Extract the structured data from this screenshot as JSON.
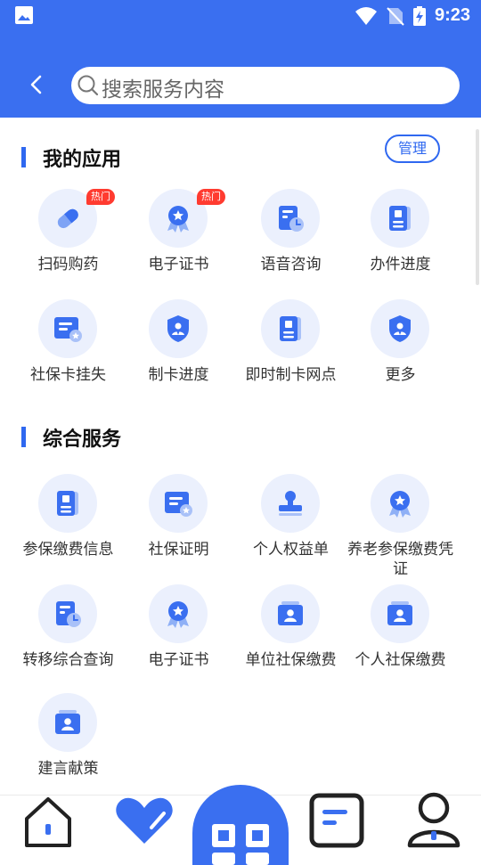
{
  "status_bar": {
    "time": "9:23",
    "icons": [
      "image-icon",
      "wifi-icon",
      "no-sim-icon",
      "battery-charging-icon"
    ]
  },
  "header": {
    "search_placeholder": "搜索服务内容",
    "back_icon": "chevron-left-icon"
  },
  "my_apps": {
    "title": "我的应用",
    "manage_label": "管理",
    "items": [
      {
        "label": "扫码购药",
        "icon": "pill-icon",
        "badge": "热门"
      },
      {
        "label": "电子证书",
        "icon": "medal-icon",
        "badge": "热门"
      },
      {
        "label": "语音咨询",
        "icon": "document-clock-icon",
        "badge": ""
      },
      {
        "label": "办件进度",
        "icon": "book-icon",
        "badge": ""
      },
      {
        "label": "社保卡挂失",
        "icon": "card-star-icon",
        "badge": ""
      },
      {
        "label": "制卡进度",
        "icon": "shield-user-icon",
        "badge": ""
      },
      {
        "label": "即时制卡网点",
        "icon": "book-icon",
        "badge": ""
      },
      {
        "label": "更多",
        "icon": "shield-user-icon",
        "badge": ""
      }
    ]
  },
  "services": {
    "title": "综合服务",
    "items": [
      {
        "label": "参保缴费信息",
        "icon": "book-icon"
      },
      {
        "label": "社保证明",
        "icon": "card-star-icon"
      },
      {
        "label": "个人权益单",
        "icon": "stamp-icon"
      },
      {
        "label": "养老参保缴费凭证",
        "icon": "medal-icon"
      },
      {
        "label": "转移综合查询",
        "icon": "document-clock-icon"
      },
      {
        "label": "电子证书",
        "icon": "medal-icon"
      },
      {
        "label": "单位社保缴费",
        "icon": "id-card-icon"
      },
      {
        "label": "个人社保缴费",
        "icon": "id-card-icon"
      },
      {
        "label": "建言献策",
        "icon": "id-card-icon"
      }
    ]
  },
  "tab_bar": {
    "tabs": [
      "home-icon",
      "heart-icon",
      "qr-code-icon",
      "document-icon",
      "profile-icon"
    ],
    "accent": "#3a6ff0"
  },
  "colors": {
    "primary": "#3a6ff0",
    "icon_bg": "#ebf0fd",
    "badge": "#ff3b30"
  }
}
